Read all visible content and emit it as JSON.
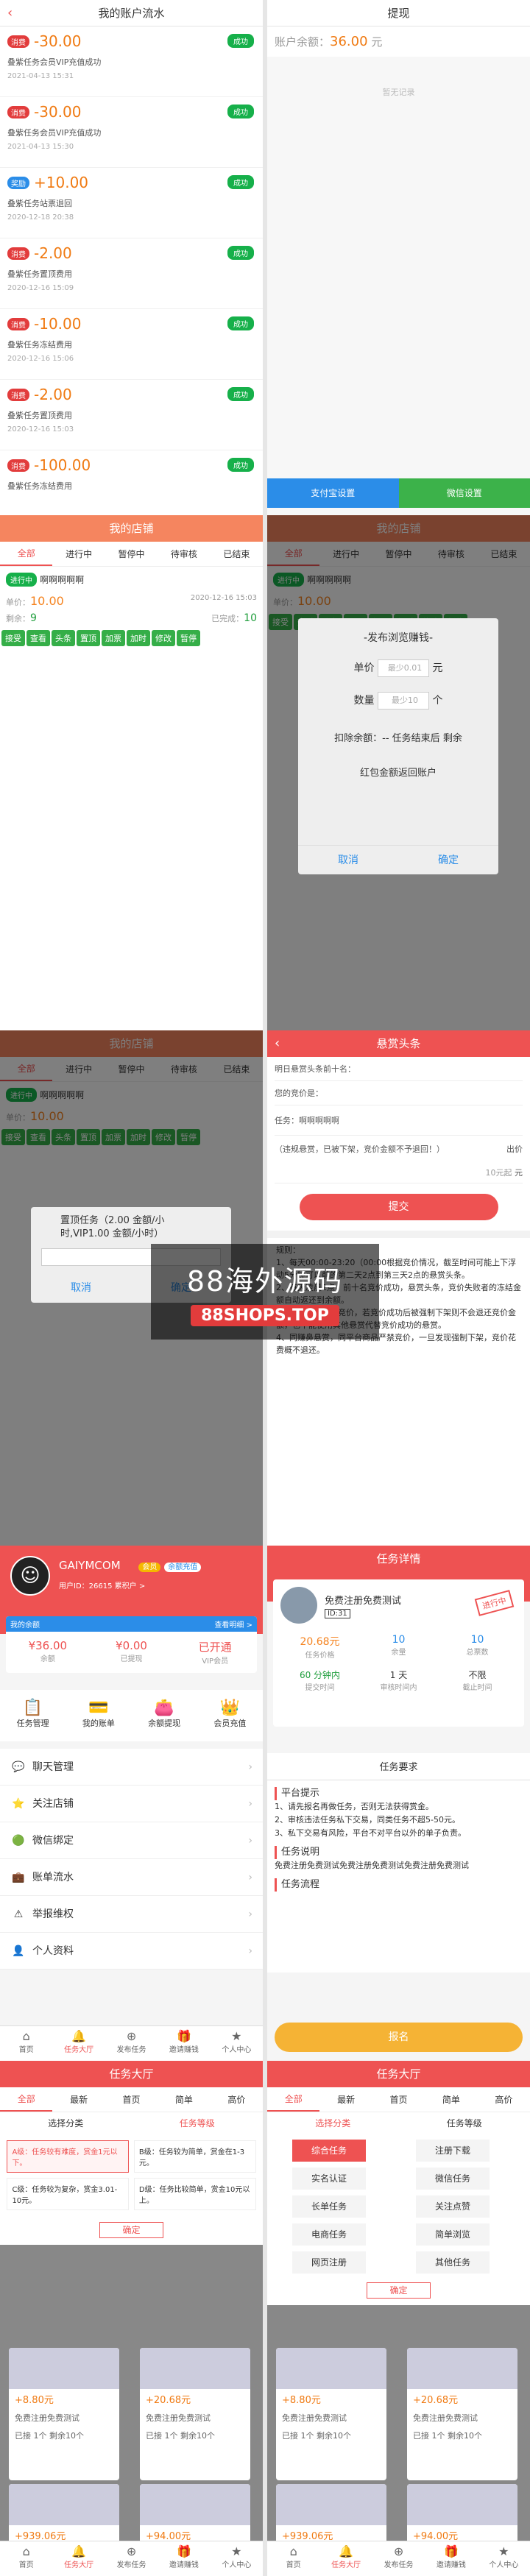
{
  "flow": {
    "title": "我的账户流水",
    "items": [
      {
        "tag": "消费",
        "amount": "-30.00",
        "status": "成功",
        "desc": "叠紫任务会员VIP充值成功",
        "date": "2021-04-13 15:31"
      },
      {
        "tag": "消费",
        "amount": "-30.00",
        "status": "成功",
        "desc": "叠紫任务会员VIP充值成功",
        "date": "2021-04-13 15:30"
      },
      {
        "tag": "奖励",
        "amount": "+10.00",
        "status": "成功",
        "desc": "叠紫任务站票退回",
        "date": "2020-12-18 20:38"
      },
      {
        "tag": "消费",
        "amount": "-2.00",
        "status": "成功",
        "desc": "叠紫任务置顶费用",
        "date": "2020-12-16 15:09"
      },
      {
        "tag": "消费",
        "amount": "-10.00",
        "status": "成功",
        "desc": "叠紫任务冻结费用",
        "date": "2020-12-16 15:06"
      },
      {
        "tag": "消费",
        "amount": "-2.00",
        "status": "成功",
        "desc": "叠紫任务置顶费用",
        "date": "2020-12-16 15:03"
      },
      {
        "tag": "消费",
        "amount": "-100.00",
        "status": "成功",
        "desc": "叠紫任务冻结费用",
        "date": ""
      }
    ]
  },
  "withdraw": {
    "title": "提现",
    "balance_label": "账户余额：",
    "balance": "36.00",
    "unit": "元",
    "empty": "暂无记录",
    "btn_alipay": "支付宝设置",
    "btn_wechat": "微信设置"
  },
  "shop": {
    "title": "我的店铺",
    "tabs": [
      "全部",
      "进行中",
      "暂停中",
      "待审核",
      "已结束"
    ],
    "status": "进行中",
    "name": "啊啊啊啊啊",
    "price_label": "单价：",
    "price": "10.00",
    "date": "2020-12-16 15:03",
    "count_label": "剩余：",
    "count": "9",
    "done_label": "已完成：",
    "done": "10",
    "actions": [
      "接受",
      "查看",
      "头条",
      "置顶",
      "加票",
      "加时",
      "修改",
      "暂停"
    ]
  },
  "publish": {
    "title": "-发布浏览赚钱-",
    "price_label": "单价",
    "price_ph": "最少0.01",
    "unit_yuan": "元",
    "qty_label": "数量",
    "qty_ph": "最少10",
    "unit_ge": "个",
    "deduct": "扣除余额：-- 任务结束后 剩余",
    "refund": "红包金额返回账户",
    "cancel": "取消",
    "confirm": "确定"
  },
  "top_dlg": {
    "text": "置顶任务（2.00 金额/小时,VIP1.00 金额/小时）",
    "cancel": "取消",
    "confirm": "确定"
  },
  "headline": {
    "title": "悬赏头条",
    "l1": "明日悬赏头条前十名：",
    "l2": "您的竞价是：",
    "l3": "任务：啊啊啊啊啊",
    "l4": "（违规悬赏，已被下架，竞价金额不予退回！）",
    "bid_label": "出价",
    "bid_ph": "10元起",
    "unit": "元",
    "submit": "提交",
    "rule_head": "规则：",
    "rules": [
      "1、每天00:00-23:20（00:00根据竞价情况，截至时间可能上下浮动5分钟可以前的第二天2点到第三天2点的悬赏头条。",
      "2、每天凌晨2点，前十名竞价成功，悬赏头条，竞价失败者的冻结金额自动返还到余额。",
      "3、违规悬赏请勿竞价，若竞价成功后被强制下架则不会退还竞价金额，也不能使用其他悬赏代替竞价成功的悬赏。",
      "4、同赚鼻悬赏，同平台商品严禁竞价，一旦发现强制下架，竞价花费概不退还。"
    ]
  },
  "watermark": {
    "a": "88海外源码",
    "b": "88SHOPS.TOP"
  },
  "user": {
    "name": "GAIYMCOM",
    "badge1": "会员",
    "badge2": "余额充值",
    "uid": "用户ID：26615 累积户 >",
    "bal_head": "我的余额",
    "bal_link": "查看明细 >",
    "stats": [
      {
        "v": "¥36.00",
        "l": "余额"
      },
      {
        "v": "¥0.00",
        "l": "已提现"
      },
      {
        "v": "已开通",
        "l": "VIP会员"
      }
    ],
    "quick": [
      "任务管理",
      "我的账单",
      "余额提现",
      "会员充值"
    ],
    "menu": [
      "聊天管理",
      "关注店铺",
      "微信绑定",
      "账单流水",
      "举报维权",
      "个人资料"
    ]
  },
  "tabbar": [
    "首页",
    "任务大厅",
    "发布任务",
    "邀请赚钱",
    "个人中心"
  ],
  "detail": {
    "title": "任务详情",
    "name": "免费注册免费测试",
    "id": "ID:31",
    "stamp": "进行中",
    "price": "20.68元",
    "price_l": "任务价格",
    "left": "10",
    "left_l": "余量",
    "total": "10",
    "total_l": "总票数",
    "time": "60 分钟内",
    "time_l": "提交时间",
    "days": "1 天",
    "days_l": "审核时间内",
    "none": "不限",
    "none_l": "截止时间",
    "req": "任务要求",
    "tips_h": "平台提示",
    "tips": [
      "1、请先报名再做任务，否则无法获得赏金。",
      "2、审核违法任务私下交易，同类任务不超5-50元。",
      "3、私下交易有风险，平台不对平台以外的单子负责。"
    ],
    "desc_h": "任务说明",
    "desc": "免费注册免费测试免费注册免费测试免费注册免费测试",
    "flow_h": "任务流程",
    "apply": "报名"
  },
  "hall": {
    "title": "任务大厅",
    "tabs": [
      "全部",
      "最新",
      "首页",
      "简单",
      "高价"
    ],
    "filter1": "选择分类",
    "filter2": "任务等级",
    "levels": [
      "A级：任务较有难度，赏金1元以下。",
      "B级：任务较为简单，赏金在1-3元。",
      "C级：任务较为复杂，赏金3.01-10元。",
      "D级：任务比较简单，赏金10元以上。"
    ],
    "ok": "确定",
    "cats": [
      "综合任务",
      "注册下载",
      "实名认证",
      "微信任务",
      "长单任务",
      "关注点赞",
      "电商任务",
      "简单浏览",
      "网页注册",
      "其他任务"
    ],
    "cards": [
      {
        "amt": "+8.80元",
        "name": "免费注册免费测试"
      },
      {
        "amt": "+20.68元",
        "name": "免费注册免费测试"
      },
      {
        "amt": "+939.06元",
        "name": "刷免费测试"
      },
      {
        "amt": "+94.00元",
        "name": "刷免费测试"
      }
    ],
    "stat": "已接 1个 剩余10个"
  }
}
